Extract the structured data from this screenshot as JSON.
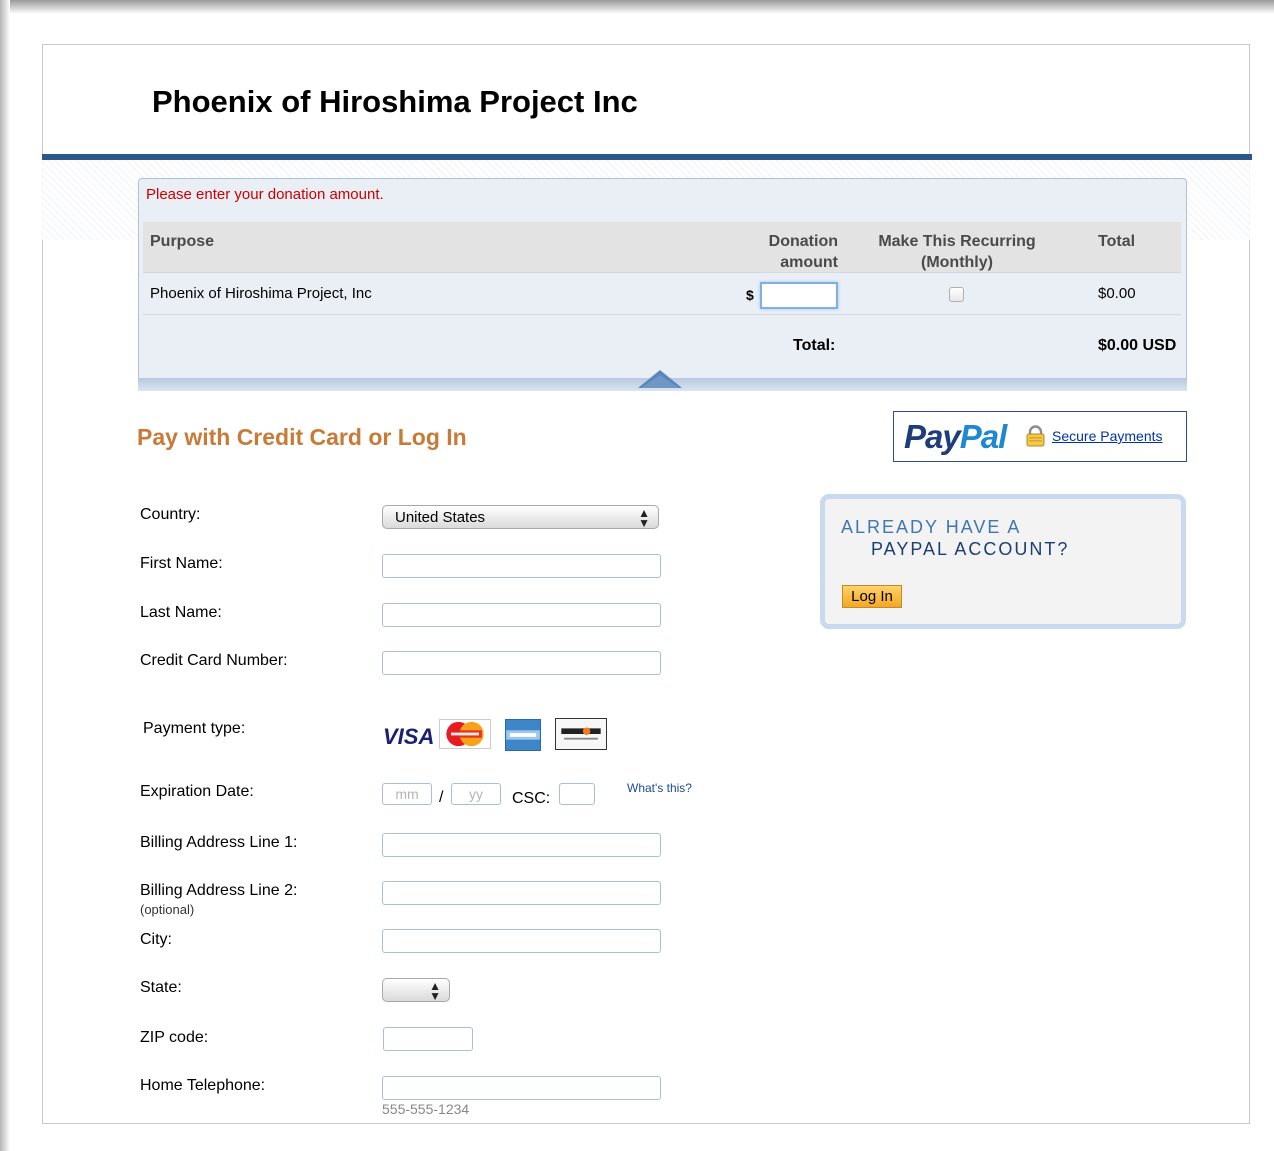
{
  "page": {
    "title": "Phoenix of Hiroshima Project Inc"
  },
  "cart": {
    "error": "Please enter your donation amount.",
    "headers": {
      "purpose": "Purpose",
      "amount_line1": "Donation",
      "amount_line2": "amount",
      "recurring_line1": "Make This Recurring",
      "recurring_line2": "(Monthly)",
      "total": "Total"
    },
    "row": {
      "purpose": "Phoenix of Hiroshima Project, Inc",
      "currency_symbol": "$",
      "amount_value": "",
      "recurring_checked": false,
      "total": "$0.00"
    },
    "total_label": "Total:",
    "total_value": "$0.00 USD"
  },
  "payment": {
    "heading": "Pay with Credit Card or Log In",
    "paypal_logo_part1": "Pay",
    "paypal_logo_part2": "Pal",
    "secure_payments": "Secure Payments",
    "fields": {
      "country": {
        "label": "Country:",
        "value": "United States"
      },
      "first_name": {
        "label": "First Name:",
        "value": ""
      },
      "last_name": {
        "label": "Last Name:",
        "value": ""
      },
      "card_number": {
        "label": "Credit Card Number:",
        "value": ""
      },
      "payment_type": {
        "label": "Payment type:",
        "cards": [
          "VISA",
          "MasterCard",
          "American Express",
          "DISCOVER"
        ]
      },
      "expiration": {
        "label": "Expiration Date:",
        "mm_placeholder": "mm",
        "yy_placeholder": "yy",
        "separator": "/",
        "csc_label": "CSC:",
        "whats_this": "What's this?"
      },
      "address1": {
        "label": "Billing Address Line 1:",
        "value": ""
      },
      "address2": {
        "label": "Billing Address Line 2:",
        "sublabel": "(optional)",
        "value": ""
      },
      "city": {
        "label": "City:",
        "value": ""
      },
      "state": {
        "label": "State:",
        "value": ""
      },
      "zip": {
        "label": "ZIP code:",
        "value": ""
      },
      "phone": {
        "label": "Home Telephone:",
        "hint": "555-555-1234",
        "value": ""
      }
    }
  },
  "login_box": {
    "line1": "ALREADY HAVE A",
    "line2": "PAYPAL ACCOUNT?",
    "button": "Log In"
  },
  "colors": {
    "header_rule": "#2c5889",
    "error_text": "#cc0000",
    "heading_orange": "#c87a37",
    "paypal_dark": "#1e3d7b",
    "paypal_light": "#1f88d1",
    "login_button": "#f5a623"
  }
}
